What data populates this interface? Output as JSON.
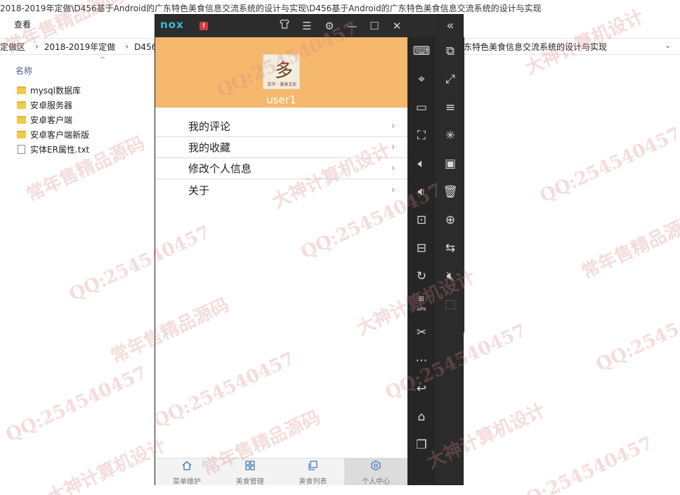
{
  "explorer": {
    "title": "2018-2019年定做\\D456基于Android的广东特色美食信息交流系统的设计与实现\\D456基于Android的广东特色美食信息交流系统的设计与实现",
    "menu_view": "查看",
    "address": [
      "定做区",
      "2018-2019年定做",
      "D456基于"
    ],
    "address_right": "东特色美食信息交流系统的设计与实现",
    "column_name": "名称",
    "files": [
      {
        "name": "mysql数据库",
        "type": "folder"
      },
      {
        "name": "安卓服务器",
        "type": "folder"
      },
      {
        "name": "安卓客户端",
        "type": "folder"
      },
      {
        "name": "安卓客户端新版",
        "type": "folder"
      },
      {
        "name": "实体ER属性.txt",
        "type": "txt"
      }
    ]
  },
  "emulator": {
    "logo": "nox",
    "alert_icon": "!",
    "titlebar_icons": [
      "shirt-icon",
      "menu-icon",
      "gear-icon",
      "minimize-icon",
      "maximize-icon",
      "close-icon"
    ],
    "collapse_icon": "double-chevron-left-icon",
    "sidebar1_icons": [
      "keyboard-icon",
      "location-icon",
      "display-icon",
      "fullscreen-icon",
      "volume-up-icon",
      "volume-down-icon",
      "screenshot-icon",
      "package-icon",
      "refresh-icon",
      "apk-icon",
      "scissors-icon",
      "more-icon",
      "back-icon",
      "home-icon",
      "recent-apps-icon"
    ],
    "sidebar2_icons": [
      "multi-window-icon",
      "resize-icon",
      "list-icon",
      "loading-icon",
      "video-icon",
      "trash-icon",
      "battery-icon",
      "swap-icon",
      "mute-icon",
      "select-icon"
    ],
    "apk_label": "APK"
  },
  "app": {
    "avatar_caption": "京华 · 美食文化",
    "username": "user1",
    "menu": [
      {
        "label": "我的评论"
      },
      {
        "label": "我的收藏"
      },
      {
        "label": "修改个人信息"
      },
      {
        "label": "关于"
      }
    ],
    "chevron": "›",
    "nav": [
      {
        "label": "菜单维护",
        "icon": "home-icon",
        "active": false
      },
      {
        "label": "美食管理",
        "icon": "grid-icon",
        "active": false
      },
      {
        "label": "美食列表",
        "icon": "copy-icon",
        "active": false
      },
      {
        "label": "个人中心",
        "icon": "person-hexagon-icon",
        "active": true
      }
    ]
  },
  "watermarks": [
    "QQ:254540457",
    "常年售精品源码",
    "大神计算机设计"
  ]
}
